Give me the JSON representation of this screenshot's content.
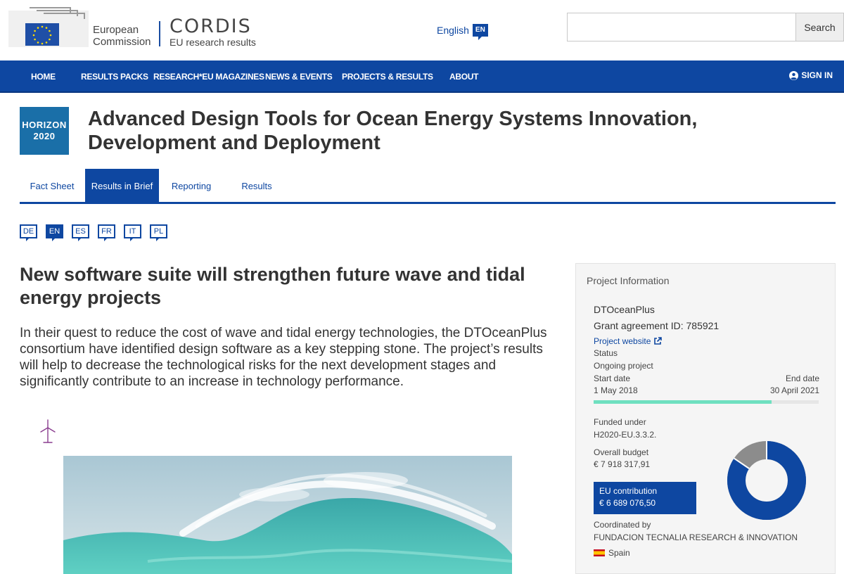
{
  "header": {
    "ec_line1": "European",
    "ec_line2": "Commission",
    "cordis_title": "CORDIS",
    "cordis_subtitle": "EU research results",
    "language_label": "English",
    "language_code": "EN",
    "search_placeholder": "",
    "search_button": "Search"
  },
  "nav": {
    "items": [
      "HOME",
      "RESULTS PACKS",
      "RESEARCH*EU MAGAZINES",
      "NEWS & EVENTS",
      "PROJECTS & RESULTS",
      "ABOUT"
    ],
    "sign_in": "SIGN IN"
  },
  "program_badge": {
    "line1": "HORIZON",
    "line2": "2020"
  },
  "project_title": "Advanced Design Tools for Ocean Energy Systems Innovation, Development and Deployment",
  "tabs": [
    {
      "label": "Fact Sheet",
      "active": false
    },
    {
      "label": "Results in Brief",
      "active": true
    },
    {
      "label": "Reporting",
      "active": false
    },
    {
      "label": "Results",
      "active": false
    }
  ],
  "languages": [
    {
      "code": "DE",
      "active": false
    },
    {
      "code": "EN",
      "active": true
    },
    {
      "code": "ES",
      "active": false
    },
    {
      "code": "FR",
      "active": false
    },
    {
      "code": "IT",
      "active": false
    },
    {
      "code": "PL",
      "active": false
    }
  ],
  "article": {
    "title": "New software suite will strengthen future wave and tidal energy projects",
    "lead": "In their quest to reduce the cost of wave and tidal energy technologies, the DTOceanPlus consortium have identified design software as a key stepping stone. The project’s results will help to decrease the technological risks for the next development stages and significantly contribute to an increase in technology performance.",
    "icon": "wind-turbine-icon"
  },
  "project_info": {
    "heading": "Project Information",
    "acronym": "DTOceanPlus",
    "grant_label": "Grant agreement ID: 785921",
    "website_label": "Project website",
    "status_label": "Status",
    "status_value": "Ongoing project",
    "start_label": "Start date",
    "end_label": "End date",
    "start_date": "1 May 2018",
    "end_date": "30 April 2021",
    "progress_fraction": 0.79,
    "funded_label": "Funded under",
    "funded_value": "H2020-EU.3.3.2.",
    "budget_label": "Overall budget",
    "budget_value": "€ 7 918 317,91",
    "eu_contribution_label": "EU contribution",
    "eu_contribution_value": "€ 6 689 076,50",
    "eu_share_fraction": 0.845,
    "coordinated_label": "Coordinated by",
    "coordinator": "FUNDACION TECNALIA RESEARCH & INNOVATION",
    "country": "Spain"
  },
  "colors": {
    "brand_blue": "#0e47a1",
    "horizon_blue": "#1a6fa8",
    "progress_green": "#6fe0c0",
    "donut_grey": "#8c8c8c"
  }
}
